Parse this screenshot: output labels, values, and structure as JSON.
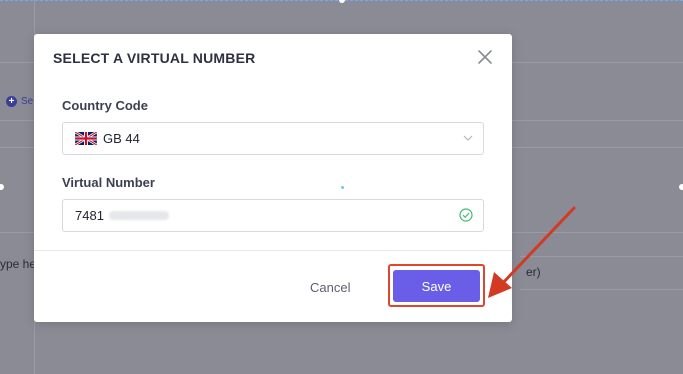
{
  "background": {
    "add_text": "Se",
    "type_here_text": "ype he",
    "right_field_text": "er)"
  },
  "modal": {
    "title": "SELECT A VIRTUAL NUMBER",
    "country_code": {
      "label": "Country Code",
      "value": "GB  44",
      "flag": "uk-flag-icon"
    },
    "virtual_number": {
      "label": "Virtual Number",
      "value": "7481",
      "status_icon": "check-circle-icon"
    },
    "buttons": {
      "cancel": "Cancel",
      "save": "Save"
    }
  },
  "colors": {
    "accent": "#6a5ee8",
    "annotation": "#e0462e",
    "success": "#3dbb73"
  }
}
